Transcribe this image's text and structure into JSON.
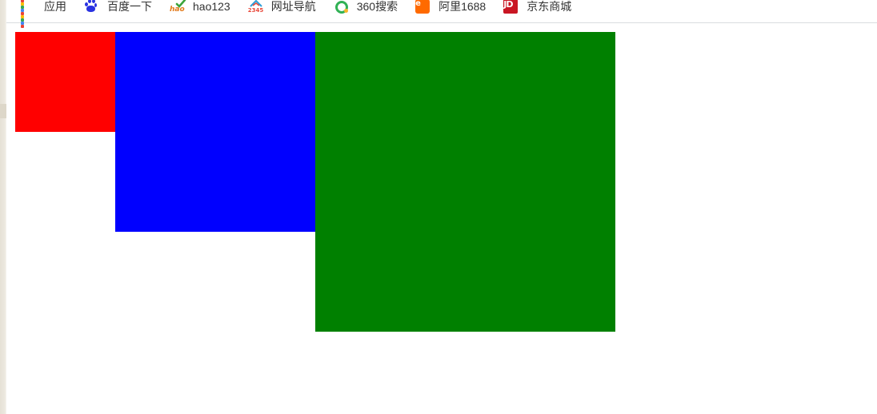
{
  "bookmarks": [
    {
      "label": "应用",
      "icon": "apps-grid-icon"
    },
    {
      "label": "百度一下",
      "icon": "baidu-paw-icon"
    },
    {
      "label": "hao123",
      "icon": "hao123-icon"
    },
    {
      "label": "网址导航",
      "icon": "nav-2345-icon"
    },
    {
      "label": "360搜索",
      "icon": "so360-icon"
    },
    {
      "label": "阿里1688",
      "icon": "ali1688-icon"
    },
    {
      "label": "京东商城",
      "icon": "jd-icon"
    }
  ],
  "boxes": [
    {
      "name": "red-box",
      "color": "#ff0000"
    },
    {
      "name": "blue-box",
      "color": "#0000ff"
    },
    {
      "name": "green-box",
      "color": "#008000"
    }
  ],
  "icon_text": {
    "hao": "hao",
    "nav": "2345",
    "ali": "e",
    "jd": "JD"
  },
  "apps_icon_colors": [
    "#ea4335",
    "#fbbc05",
    "#34a853",
    "#4285f4",
    "#ea4335",
    "#fbbc05",
    "#34a853",
    "#4285f4",
    "#ea4335"
  ]
}
